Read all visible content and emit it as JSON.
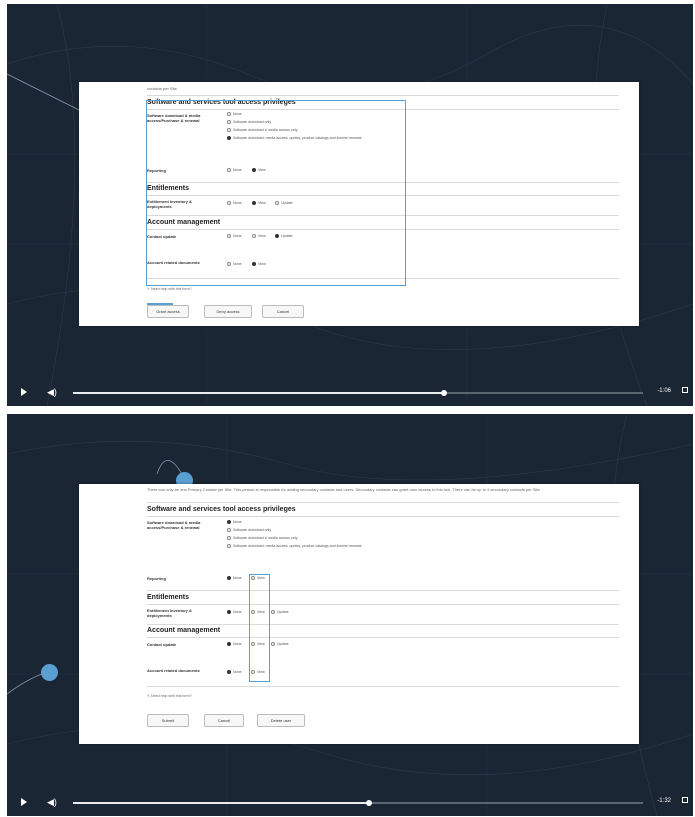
{
  "colors": {
    "player_bg": "#1b2634",
    "accent": "#5a9fd4",
    "card_bg": "#ffffff"
  },
  "icons": {
    "play": "play-icon",
    "volume": "volume-icon",
    "fullscreen": "fullscreen-icon",
    "help": "pencil-icon"
  },
  "frame1": {
    "intro": "contacts per Site.",
    "section_software": "Software and services tool access privileges",
    "label_software": "Software download & media access/Purchase & renewal",
    "software_options": [
      "None",
      "Software download only",
      "Software download & media access only",
      "Software download, media access, quotes, product catalogs and license renewal"
    ],
    "label_reporting": "Reporting",
    "reporting_options": [
      "None",
      "View"
    ],
    "section_entitlements": "Entitlements",
    "label_entitlement": "Entitlement Inventory & deployments",
    "entitlement_options": [
      "None",
      "View",
      "Update"
    ],
    "section_account": "Account management",
    "label_contact": "Contact update",
    "contact_options": [
      "None",
      "View",
      "Update"
    ],
    "label_docs": "Account related documents",
    "docs_options": [
      "None",
      "View"
    ],
    "help_link": "Need help with this form?",
    "buttons": [
      "Grant access",
      "Deny access",
      "Cancel"
    ],
    "progress": 0.65,
    "time": "-1:06"
  },
  "frame2": {
    "intro": "There can only be one Primary Contact per Site. This person is responsible for adding secondary contacts and users. Secondary contacts can grant user access to this tool. There can be up to 4 secondary contacts per Site.",
    "section_software": "Software and services tool access privileges",
    "label_software": "Software download & media access/Purchase & renewal",
    "software_options": [
      "None",
      "Software download only",
      "Software download & media access only",
      "Software download, media access, quotes, product catalogs and license renewal"
    ],
    "label_reporting": "Reporting",
    "reporting_options": [
      "None",
      "View"
    ],
    "section_entitlements": "Entitlements",
    "label_entitlement": "Entitlement Inventory & deployments",
    "entitlement_options": [
      "None",
      "View",
      "Update"
    ],
    "section_account": "Account management",
    "label_contact": "Contact update",
    "contact_options": [
      "None",
      "View",
      "Update"
    ],
    "label_docs": "Account related documents",
    "docs_options": [
      "None",
      "View"
    ],
    "help_link": "Need help with this form?",
    "buttons": [
      "Submit",
      "Cancel",
      "Delete user"
    ],
    "progress": 0.52,
    "time": "-1:32"
  }
}
